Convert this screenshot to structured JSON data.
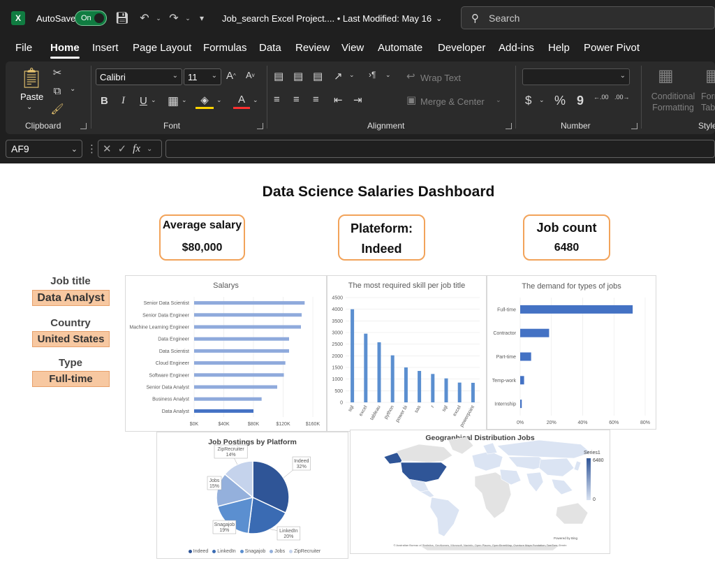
{
  "app": {
    "logo_letter": "X",
    "autosave_label": "AutoSave",
    "autosave_state": "On",
    "file_title": "Job_search Excel Project.... • Last Modified: May 16",
    "search_placeholder": "Search",
    "accent": "#107c41"
  },
  "menu": {
    "tabs": [
      "File",
      "Home",
      "Insert",
      "Page Layout",
      "Formulas",
      "Data",
      "Review",
      "View",
      "Automate",
      "Developer",
      "Add-ins",
      "Help",
      "Power Pivot"
    ],
    "active": "Home"
  },
  "ribbon": {
    "clipboard": {
      "label": "Clipboard",
      "paste": "Paste"
    },
    "font": {
      "label": "Font",
      "font_name": "Calibri",
      "font_size": "11",
      "grow": "A",
      "shrink": "A",
      "bold": "B",
      "italic": "I",
      "underline": "U",
      "font_color": "A"
    },
    "alignment": {
      "label": "Alignment",
      "wrap_text": "Wrap Text",
      "merge_center": "Merge & Center"
    },
    "number": {
      "label": "Number",
      "currency": "$",
      "percent": "%",
      "comma": "9",
      "increase_decimal": ".00",
      "decrease_decimal": ".00"
    },
    "styles": {
      "label": "Style",
      "conditional_formatting": "Conditional Formatting",
      "format_table": "Forr Tab"
    }
  },
  "formula_bar": {
    "cell_ref": "AF9",
    "fx": "fx",
    "value": ""
  },
  "dashboard": {
    "title": "Data Science  Salaries Dashboard",
    "kpis": [
      {
        "label": "Average salary",
        "value": "$80,000"
      },
      {
        "label": "Plateform:",
        "value": "Indeed"
      },
      {
        "label": "Job count",
        "value": "6480"
      }
    ],
    "filters": [
      {
        "label": "Job title",
        "value": "Data Analyst"
      },
      {
        "label": "Country",
        "value": "United States"
      },
      {
        "label": "Type",
        "value": "Full-time"
      }
    ]
  },
  "chart_data": [
    {
      "type": "bar",
      "orientation": "horizontal",
      "title": "Salarys",
      "categories": [
        "Senior Data Scientist",
        "Senior Data Engineer",
        "Machine Learning Engineer",
        "Data Engineer",
        "Data Scientist",
        "Cloud Engineer",
        "Software Engineer",
        "Senior Data Analyst",
        "Business Analyst",
        "Data Analyst"
      ],
      "values": [
        149000,
        145000,
        144000,
        128000,
        128000,
        123000,
        121000,
        112000,
        91000,
        80000
      ],
      "highlight": "Data Analyst",
      "xticks": [
        "$0K",
        "$40K",
        "$80K",
        "$120K",
        "$160K"
      ],
      "xlim": [
        0,
        160000
      ],
      "colors": {
        "bar": "#8faadc",
        "highlight": "#4472c4"
      }
    },
    {
      "type": "bar",
      "orientation": "vertical",
      "title": "The most required skill per job title",
      "categories": [
        "sql",
        "excel",
        "tableau",
        "python",
        "power bi",
        "sas",
        "r",
        "sql",
        "excel",
        "powerpoint"
      ],
      "values": [
        4000,
        2950,
        2580,
        2020,
        1500,
        1350,
        1220,
        1030,
        850,
        840
      ],
      "yticks": [
        "0",
        "500",
        "1000",
        "1500",
        "2000",
        "2500",
        "3000",
        "3500",
        "4000",
        "4500"
      ],
      "ylim": [
        0,
        4500
      ],
      "colors": {
        "bar": "#5b8fd0"
      }
    },
    {
      "type": "bar",
      "orientation": "horizontal",
      "title": "The demand for types of jobs",
      "categories": [
        "Full-time",
        "Contractor",
        "Part-time",
        "Temp-work",
        "Internship"
      ],
      "values": [
        0.72,
        0.185,
        0.07,
        0.025,
        0.01
      ],
      "xticks": [
        "0%",
        "20%",
        "40%",
        "60%",
        "80%"
      ],
      "xlim": [
        0,
        0.8
      ],
      "colors": {
        "bar": "#4472c4"
      }
    },
    {
      "type": "pie",
      "title": "Job Postings by Platform",
      "slices": [
        {
          "name": "Indeed",
          "value": 32,
          "label": "32%",
          "color": "#2f5597"
        },
        {
          "name": "LinkedIn",
          "value": 20,
          "label": "20%",
          "color": "#3a6bb3"
        },
        {
          "name": "Snagajob",
          "value": 19,
          "label": "19%",
          "color": "#5b8fd0"
        },
        {
          "name": "Jobs",
          "value": 15,
          "label": "15%",
          "color": "#94b0dc"
        },
        {
          "name": "ZipRecruiter",
          "value": 14,
          "label": "14%",
          "color": "#c5d3ec"
        }
      ],
      "legend": "bottom"
    },
    {
      "type": "map",
      "title": "Geographical Distribution Jobs",
      "legend_series": "Series1",
      "legend_max": "6480",
      "legend_min": "0",
      "highlight_region": "United States",
      "attribution_right": "Powered by Bing",
      "attribution_bottom": "© Australian Bureau of Statistics, GeoNames, Microsoft, Navinfo, Open Places, OpenStreetMap, Overture Maps Fundation, TomTom, Zenrin",
      "colors": {
        "high": "#2f5597",
        "land": "#dbe4f3",
        "none": "#e3e3e3"
      }
    }
  ]
}
